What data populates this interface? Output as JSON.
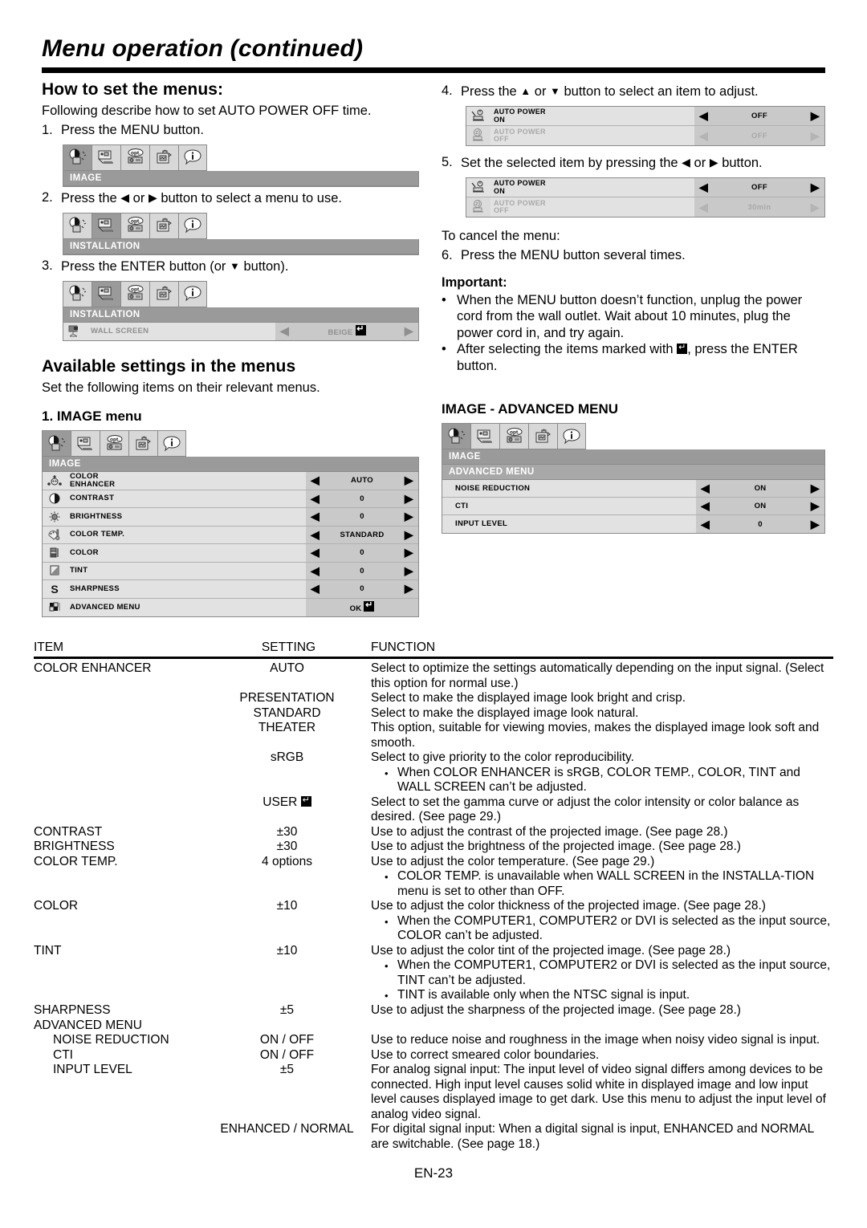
{
  "header": {
    "title": "Menu operation (continued)"
  },
  "left": {
    "h_how": "How to set the menus:",
    "intro": "Following describe how to set AUTO POWER OFF time.",
    "step1": {
      "num": "1.",
      "text": "Press the MENU button."
    },
    "step2": {
      "num": "2.",
      "pre": "Press the",
      "mid": "or",
      "post": "button to select a menu to use."
    },
    "step3": {
      "num": "3.",
      "pre": "Press the ENTER button (or",
      "post": "button)."
    },
    "h_avail": "Available settings in the menus",
    "avail_intro": "Set the following items on their relevant menus.",
    "h_image_menu": "1. IMAGE menu"
  },
  "right": {
    "step4": {
      "num": "4.",
      "pre": "Press the",
      "mid": "or",
      "post": "button to select an item to adjust."
    },
    "step5": {
      "num": "5.",
      "pre": "Set the selected item by pressing the",
      "mid": "or",
      "post": "button."
    },
    "cancel_label": "To cancel the menu:",
    "step6": {
      "num": "6.",
      "text": "Press the MENU button several times."
    },
    "important_title": "Important:",
    "bullets": [
      "When the MENU button doesn’t function, unplug the power cord from the wall outlet. Wait about 10 minutes, plug the power cord in, and try again.",
      {
        "pre": "After selecting the items marked with",
        "post": ", press the ENTER button."
      }
    ],
    "h_advanced_menu": "IMAGE - ADVANCED MENU"
  },
  "osd": {
    "tabs": [
      "image-tab",
      "installation-tab",
      "option-tab",
      "signal-tab",
      "info-tab"
    ],
    "image_label": "IMAGE",
    "installation_label": "INSTALLATION",
    "advanced_label": "ADVANCED MENU",
    "wall_screen": {
      "icon": "wall-screen-icon",
      "label": "WALL SCREEN",
      "value": "BEIGE",
      "has_enter": true
    },
    "auto_power_step4": [
      {
        "icon": "auto-power-on-icon",
        "label1": "AUTO POWER",
        "label2": "ON",
        "value": "OFF",
        "dim": false
      },
      {
        "icon": "auto-power-off-icon",
        "label1": "AUTO POWER",
        "label2": "OFF",
        "value": "OFF",
        "dim": true
      }
    ],
    "auto_power_step5": [
      {
        "icon": "auto-power-on-icon",
        "label1": "AUTO POWER",
        "label2": "ON",
        "value": "OFF",
        "dim": false
      },
      {
        "icon": "auto-power-off-icon",
        "label1": "AUTO POWER",
        "label2": "OFF",
        "value": "30min",
        "dim": true
      }
    ],
    "image_rows": [
      {
        "icon": "color-enhancer-icon",
        "label1": "COLOR",
        "label2": "ENHANCER",
        "value": "AUTO"
      },
      {
        "icon": "contrast-icon",
        "label1": "CONTRAST",
        "label2": "",
        "value": "0"
      },
      {
        "icon": "brightness-icon",
        "label1": "BRIGHTNESS",
        "label2": "",
        "value": "0"
      },
      {
        "icon": "color-temp-icon",
        "label1": "COLOR TEMP.",
        "label2": "",
        "value": "STANDARD"
      },
      {
        "icon": "color-icon",
        "label1": "COLOR",
        "label2": "",
        "value": "0"
      },
      {
        "icon": "tint-icon",
        "label1": "TINT",
        "label2": "",
        "value": "0"
      },
      {
        "icon": "sharpness-icon",
        "label1": "SHARPNESS",
        "label2": "",
        "value": "0"
      },
      {
        "icon": "advanced-menu-icon",
        "label1": "ADVANCED MENU",
        "label2": "",
        "value": "OK",
        "ok": true
      }
    ],
    "advanced_rows": [
      {
        "label": "NOISE REDUCTION",
        "value": "ON"
      },
      {
        "label": "CTI",
        "value": "ON"
      },
      {
        "label": "INPUT LEVEL",
        "value": "0"
      }
    ]
  },
  "table": {
    "headers": {
      "item": "ITEM",
      "setting": "SETTING",
      "function": "FUNCTION"
    },
    "rows": [
      {
        "item": "COLOR ENHANCER",
        "setting": "AUTO",
        "function": "Select to optimize the settings automatically depending on the input signal. (Select this option for normal use.)",
        "notes": []
      },
      {
        "item": "",
        "setting": "PRESENTATION",
        "function": "Select to make the displayed image look bright and crisp.",
        "notes": []
      },
      {
        "item": "",
        "setting": "STANDARD",
        "function": "Select to make the displayed image look natural.",
        "notes": []
      },
      {
        "item": "",
        "setting": "THEATER",
        "function": "This option, suitable for viewing movies, makes the displayed image look soft and smooth.",
        "notes": []
      },
      {
        "item": "",
        "setting": "sRGB",
        "function": "Select to give priority to the color reproducibility.",
        "notes": [
          "When COLOR ENHANCER is sRGB, COLOR TEMP., COLOR, TINT and WALL SCREEN can’t be adjusted."
        ]
      },
      {
        "item": "",
        "setting": "USER",
        "setting_enter": true,
        "function": "Select to set the gamma curve or adjust the color intensity or color balance as desired. (See page 29.)",
        "notes": []
      },
      {
        "item": "CONTRAST",
        "setting": "±30",
        "function": "Use to adjust the contrast of the projected image. (See page 28.)",
        "notes": []
      },
      {
        "item": "BRIGHTNESS",
        "setting": "±30",
        "function": "Use to adjust the brightness of the projected image. (See page 28.)",
        "notes": []
      },
      {
        "item": "COLOR TEMP.",
        "setting": "4 options",
        "function": "Use to adjust the color temperature. (See page 29.)",
        "notes": [
          "COLOR TEMP. is unavailable when WALL SCREEN in the INSTALLA-TION menu is set to other than OFF."
        ]
      },
      {
        "item": "COLOR",
        "setting": "±10",
        "function": "Use to adjust the color thickness of the projected image. (See page 28.)",
        "notes": [
          "When the COMPUTER1, COMPUTER2 or DVI is selected as the input source, COLOR can’t be adjusted."
        ]
      },
      {
        "item": "TINT",
        "setting": "±10",
        "function": "Use to adjust the color tint of the projected image. (See page 28.)",
        "notes": [
          "When the COMPUTER1, COMPUTER2 or DVI is selected as the input source, TINT can’t be adjusted.",
          "TINT is available only when the NTSC signal is input."
        ]
      },
      {
        "item": "SHARPNESS",
        "setting": "±5",
        "function": "Use to adjust the sharpness of the projected image. (See page 28.)",
        "notes": []
      },
      {
        "item": "ADVANCED MENU",
        "setting": "",
        "function": "",
        "notes": []
      },
      {
        "item": "NOISE REDUCTION",
        "indent": true,
        "setting": "ON / OFF",
        "function": "Use to reduce noise and roughness in the image when noisy video signal is input.",
        "notes": []
      },
      {
        "item": "CTI",
        "indent": true,
        "setting": "ON / OFF",
        "function": "Use to correct smeared color boundaries.",
        "notes": []
      },
      {
        "item": "INPUT LEVEL",
        "indent": true,
        "setting": "±5",
        "function": "For analog signal input: The input level of video signal differs among devices to be connected. High input level causes solid white in displayed image and low input level causes displayed image to get dark. Use this menu to adjust the input level of analog video signal.",
        "notes": []
      },
      {
        "item": "",
        "setting": "ENHANCED / NORMAL",
        "function": "For digital signal input: When a digital signal is input, ENHANCED and NORMAL are switchable. (See page 18.)",
        "notes": []
      }
    ]
  },
  "footer": {
    "page": "EN-23"
  }
}
